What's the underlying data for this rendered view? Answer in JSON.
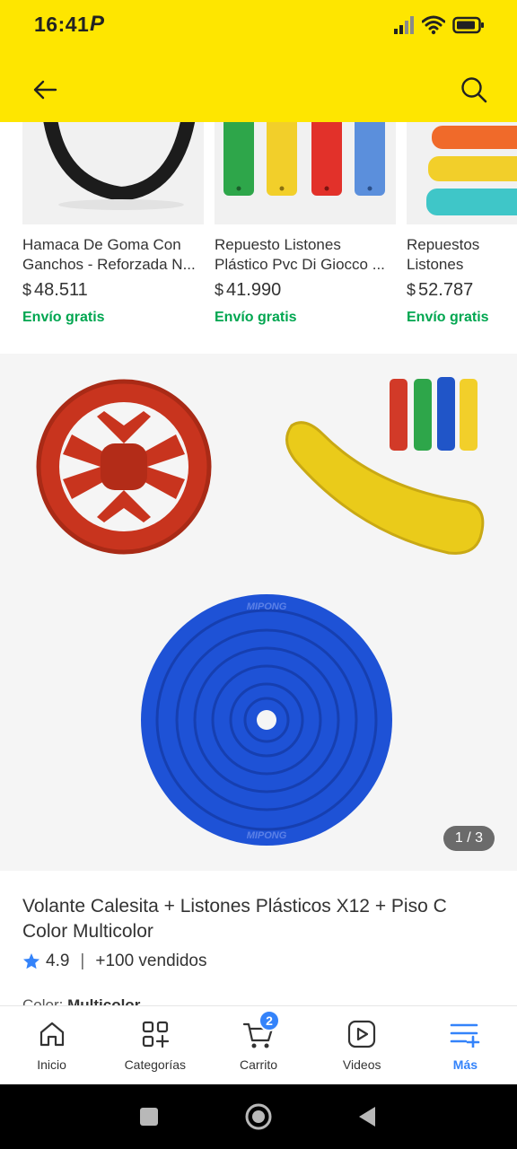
{
  "status_bar": {
    "time": "16:41",
    "app_indicator": "P"
  },
  "header": {
    "back_icon": "arrow-left-icon",
    "search_icon": "search-icon",
    "accent": "#fee600"
  },
  "related": [
    {
      "title": "Hamaca De Goma Con Ganchos - Reforzada N...",
      "currency": "$",
      "price": "48.511",
      "shipping": "Envío gratis"
    },
    {
      "title": "Repuesto Listones Plástico Pvc Di Giocco ...",
      "currency": "$",
      "price": "41.990",
      "shipping": "Envío gratis"
    },
    {
      "title": "Repuestos Listones Hamaca Calesita",
      "currency": "$",
      "price": "52.787",
      "shipping": "Envío gratis"
    }
  ],
  "gallery": {
    "counter": "1 / 3",
    "brand_text": "MIPONG"
  },
  "product": {
    "title": "Volante Calesita + Listones Plásticos X12 + Piso C\nColor Multicolor",
    "rating": "4.9",
    "separator": "|",
    "sold": "+100 vendidos",
    "color_label": "Color:",
    "color_value": "Multicolor"
  },
  "bottom_nav": {
    "items": [
      {
        "label": "Inicio",
        "icon": "home-icon"
      },
      {
        "label": "Categorías",
        "icon": "categories-icon"
      },
      {
        "label": "Carrito",
        "icon": "cart-icon",
        "badge": "2"
      },
      {
        "label": "Videos",
        "icon": "video-icon"
      },
      {
        "label": "Más",
        "icon": "more-icon",
        "active": true
      }
    ]
  },
  "colors": {
    "shipping_green": "#00a650",
    "accent_blue": "#3483fa"
  }
}
